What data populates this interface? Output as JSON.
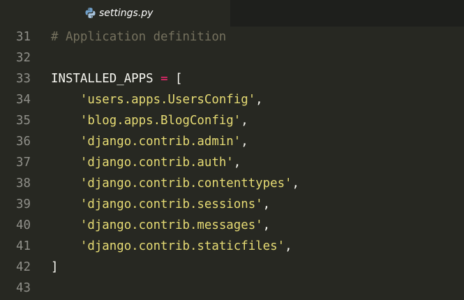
{
  "tab": {
    "filename": "settings.py",
    "icon": "python-icon"
  },
  "colors": {
    "background": "#272822",
    "tabbar": "#1e1f1c",
    "gutter_text": "#90908a",
    "comment": "#75715e",
    "keyword_operator": "#f92672",
    "string": "#e6db74",
    "default_text": "#f8f8f2"
  },
  "lines": [
    {
      "number": "31",
      "comment": "# Application definition"
    },
    {
      "number": "32"
    },
    {
      "number": "33",
      "ident": "INSTALLED_APPS",
      "op": " = ",
      "punct": "["
    },
    {
      "number": "34",
      "indent": "    ",
      "string": "'users.apps.UsersConfig'",
      "punct": ","
    },
    {
      "number": "35",
      "indent": "    ",
      "string": "'blog.apps.BlogConfig'",
      "punct": ","
    },
    {
      "number": "36",
      "indent": "    ",
      "string": "'django.contrib.admin'",
      "punct": ","
    },
    {
      "number": "37",
      "indent": "    ",
      "string": "'django.contrib.auth'",
      "punct": ","
    },
    {
      "number": "38",
      "indent": "    ",
      "string": "'django.contrib.contenttypes'",
      "punct": ","
    },
    {
      "number": "39",
      "indent": "    ",
      "string": "'django.contrib.sessions'",
      "punct": ","
    },
    {
      "number": "40",
      "indent": "    ",
      "string": "'django.contrib.messages'",
      "punct": ","
    },
    {
      "number": "41",
      "indent": "    ",
      "string": "'django.contrib.staticfiles'",
      "punct": ","
    },
    {
      "number": "42",
      "punct": "]"
    },
    {
      "number": "43"
    }
  ]
}
